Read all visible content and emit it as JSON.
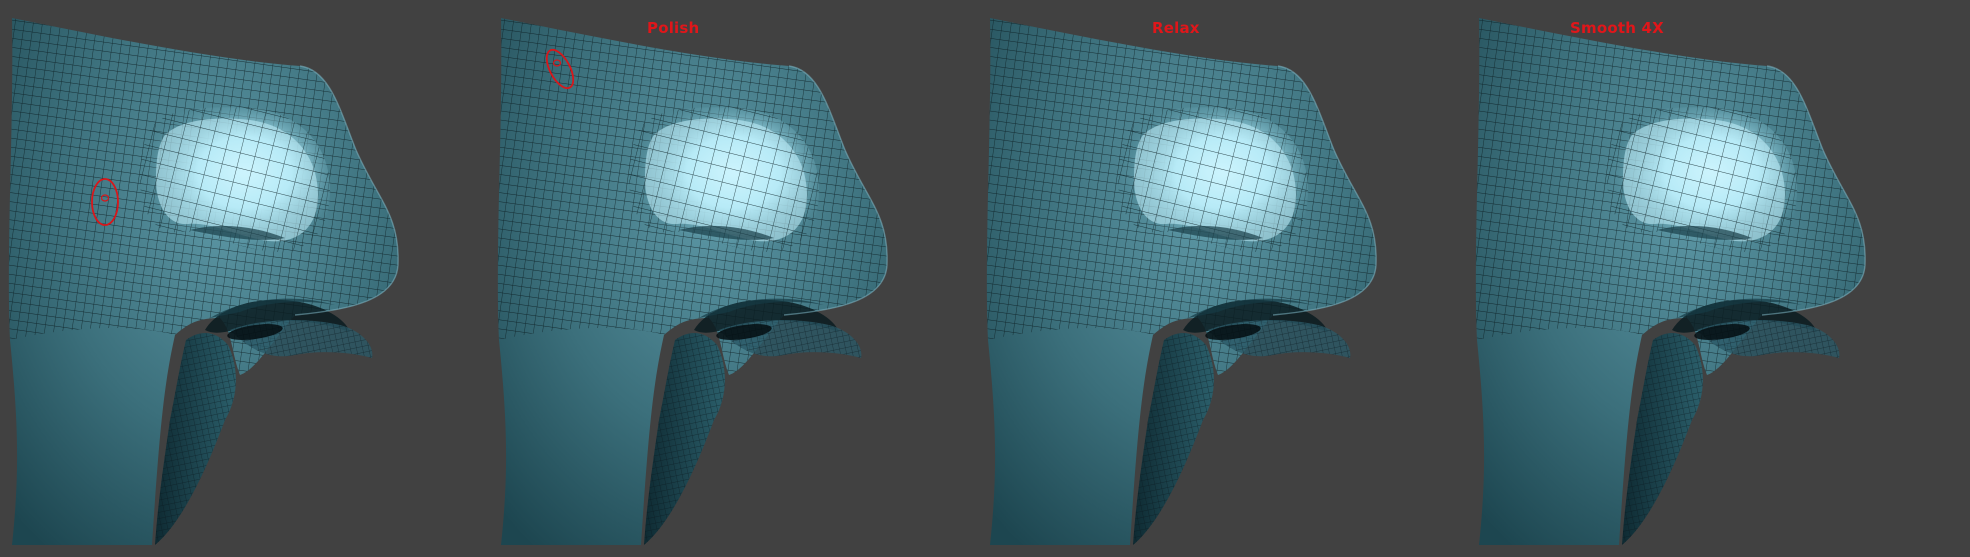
{
  "labels": {
    "polish": "Polish",
    "relax": "Relax",
    "smooth": "Smooth 4X"
  },
  "colors": {
    "background": "#414141",
    "label": "#e0161a",
    "brush_cursor": "#d8171b",
    "mesh_wire": "#08161b",
    "mesh_dark": "#173c46",
    "mesh_mid": "#3d7582",
    "mesh_light": "#7fbfcf",
    "mesh_highlight": "#bff0fa"
  },
  "icons": {
    "brush_cursor": "brush-cursor-icon"
  }
}
